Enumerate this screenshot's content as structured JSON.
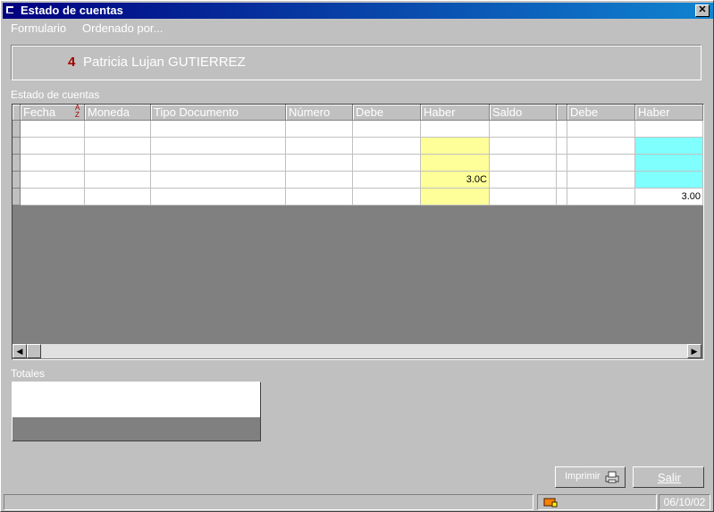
{
  "window": {
    "title": "Estado de cuentas",
    "close_label": "✕"
  },
  "menu": {
    "formulario": "Formulario",
    "ordenado": "Ordenado por..."
  },
  "person": {
    "number": "4",
    "name": "Patricia Lujan  GUTIERREZ"
  },
  "section_label": "Estado de cuentas",
  "sort_icon_text": "AZ",
  "columns": [
    "Fecha",
    "Moneda",
    "Tipo Documento",
    "Número",
    "Debe",
    "Haber",
    "Saldo",
    "",
    "Debe",
    "Haber"
  ],
  "rows": [
    [
      "",
      "",
      "",
      "",
      "",
      "",
      "",
      "",
      "",
      ""
    ],
    [
      "",
      "",
      "",
      "",
      "",
      "",
      "",
      "",
      "",
      ""
    ],
    [
      "",
      "",
      "",
      "",
      "",
      "",
      "",
      "",
      "",
      ""
    ],
    [
      "",
      "",
      "",
      "",
      "",
      "3.0C",
      "",
      "",
      "",
      ""
    ],
    [
      "",
      "",
      "",
      "",
      "",
      "",
      "",
      "",
      "",
      "3.00"
    ]
  ],
  "totales_label": "Totales",
  "buttons": {
    "imprimir": "Imprimir",
    "salir": "Salir"
  },
  "status": {
    "date": "06/10/02"
  },
  "colors": {
    "yellow": "#ffff99",
    "cyan": "#80ffff",
    "title_start": "#000080",
    "title_end": "#1084d0"
  }
}
